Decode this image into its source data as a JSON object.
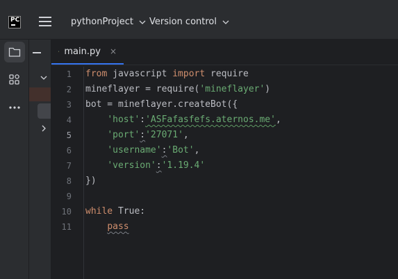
{
  "titlebar": {
    "logo_text": "PC",
    "project_label": "pythonProject",
    "vcs_label": "Version control"
  },
  "toolstrip": {
    "icons": [
      "folder-icon",
      "structure-icon",
      "more-icon"
    ]
  },
  "editor": {
    "tab_label": "main.py",
    "tab_close": "×",
    "current_line": 5,
    "lines": [
      {
        "no": "1",
        "segments": [
          [
            "kw",
            "from"
          ],
          [
            "p",
            " javascript "
          ],
          [
            "kw",
            "import"
          ],
          [
            "p",
            " require"
          ]
        ]
      },
      {
        "no": "2",
        "segments": [
          [
            "p",
            "mineflayer = require("
          ],
          [
            "str",
            "'mineflayer'"
          ],
          [
            "p",
            ")"
          ]
        ]
      },
      {
        "no": "3",
        "segments": [
          [
            "p",
            "bot = mineflayer.createBot({"
          ]
        ]
      },
      {
        "no": "4",
        "segments": [
          [
            "p",
            "    "
          ],
          [
            "str",
            "'host'"
          ],
          [
            "p",
            ":"
          ],
          [
            "strq",
            "'ASFafasfefs.aternos.me'"
          ],
          [
            "p",
            ","
          ]
        ]
      },
      {
        "no": "5",
        "segments": [
          [
            "p",
            "    "
          ],
          [
            "str",
            "'port'"
          ],
          [
            "pq",
            ":"
          ],
          [
            "str",
            "'27071'"
          ],
          [
            "p",
            ","
          ]
        ]
      },
      {
        "no": "6",
        "segments": [
          [
            "p",
            "    "
          ],
          [
            "str",
            "'username'"
          ],
          [
            "pq",
            ":"
          ],
          [
            "str",
            "'Bot'"
          ],
          [
            "p",
            ","
          ]
        ]
      },
      {
        "no": "7",
        "segments": [
          [
            "p",
            "    "
          ],
          [
            "str",
            "'version'"
          ],
          [
            "pq",
            ":"
          ],
          [
            "str",
            "'1.19.4'"
          ]
        ]
      },
      {
        "no": "8",
        "segments": [
          [
            "p",
            "})"
          ]
        ]
      },
      {
        "no": "9",
        "segments": []
      },
      {
        "no": "10",
        "segments": [
          [
            "kw",
            "while"
          ],
          [
            "p",
            " True:"
          ]
        ]
      },
      {
        "no": "11",
        "segments": [
          [
            "p",
            "    "
          ],
          [
            "kwq",
            "pass"
          ]
        ]
      }
    ]
  }
}
